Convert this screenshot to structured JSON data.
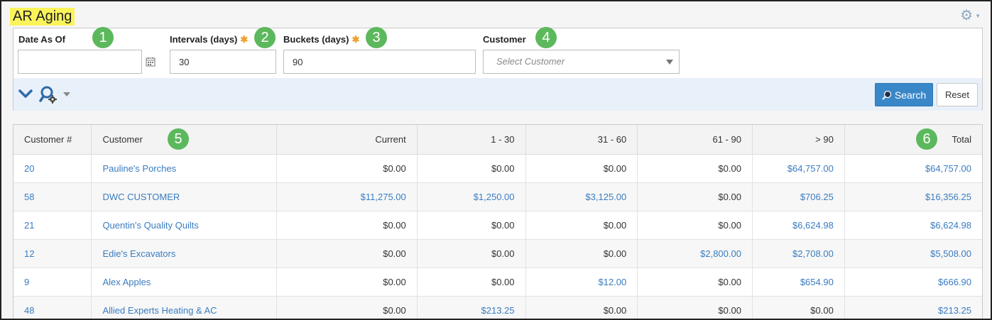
{
  "page": {
    "title": "AR Aging"
  },
  "filters": {
    "date_as_of": {
      "label": "Date As Of",
      "value": ""
    },
    "intervals": {
      "label": "Intervals (days)",
      "required_mark": "✱",
      "value": "30"
    },
    "buckets": {
      "label": "Buckets (days)",
      "required_mark": "✱",
      "value": "90"
    },
    "customer": {
      "label": "Customer",
      "placeholder": "Select Customer"
    }
  },
  "toolbar": {
    "search_label": "Search",
    "reset_label": "Reset"
  },
  "badges": [
    "1",
    "2",
    "3",
    "4",
    "5",
    "6"
  ],
  "table": {
    "headers": [
      "Customer #",
      "Customer",
      "Current",
      "1 - 30",
      "31 - 60",
      "61 - 90",
      "> 90",
      "Total"
    ],
    "rows": [
      {
        "num": "20",
        "name": "Pauline's Porches",
        "current": "$0.00",
        "d1_30": "$0.00",
        "d31_60": "$0.00",
        "d61_90": "$0.00",
        "over90": "$64,757.00",
        "total": "$64,757.00"
      },
      {
        "num": "58",
        "name": "DWC CUSTOMER",
        "current": "$11,275.00",
        "d1_30": "$1,250.00",
        "d31_60": "$3,125.00",
        "d61_90": "$0.00",
        "over90": "$706.25",
        "total": "$16,356.25"
      },
      {
        "num": "21",
        "name": "Quentin's Quality Quilts",
        "current": "$0.00",
        "d1_30": "$0.00",
        "d31_60": "$0.00",
        "d61_90": "$0.00",
        "over90": "$6,624.98",
        "total": "$6,624.98"
      },
      {
        "num": "12",
        "name": "Edie's Excavators",
        "current": "$0.00",
        "d1_30": "$0.00",
        "d31_60": "$0.00",
        "d61_90": "$2,800.00",
        "over90": "$2,708.00",
        "total": "$5,508.00"
      },
      {
        "num": "9",
        "name": "Alex Apples",
        "current": "$0.00",
        "d1_30": "$0.00",
        "d31_60": "$12.00",
        "d61_90": "$0.00",
        "over90": "$654.90",
        "total": "$666.90"
      },
      {
        "num": "48",
        "name": "Allied Experts Heating & AC",
        "current": "$0.00",
        "d1_30": "$213.25",
        "d31_60": "$0.00",
        "d61_90": "$0.00",
        "over90": "$0.00",
        "total": "$213.25"
      }
    ]
  },
  "colors": {
    "highlight": "#fbf35a",
    "link": "#3a7cc0",
    "badge": "#5cb85c",
    "search_button": "#3a87c8",
    "required": "#f0a030"
  },
  "icons": [
    "gear-icon",
    "calendar-icon",
    "chevron-down-icon",
    "search-options-icon",
    "search-icon",
    "dropdown-arrow-icon"
  ]
}
